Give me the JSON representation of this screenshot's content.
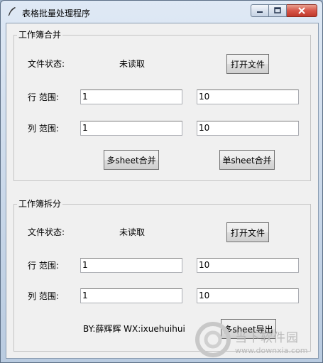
{
  "window": {
    "title": "表格批量处理程序",
    "controls": {
      "minimize": "minimize",
      "maximize": "maximize",
      "close": "close"
    }
  },
  "merge": {
    "legend": "工作簿合并",
    "status_label": "文件状态:",
    "status_value": "未读取",
    "open_button": "打开文件",
    "row_label": "行  范围:",
    "row_start": "1",
    "row_end": "10",
    "col_label": "列  范围:",
    "col_start": "1",
    "col_end": "10",
    "multi_button": "多sheet合并",
    "single_button": "单sheet合并"
  },
  "split": {
    "legend": "工作簿拆分",
    "status_label": "文件状态:",
    "status_value": "未读取",
    "open_button": "打开文件",
    "row_label": "行  范围:",
    "row_start": "1",
    "row_end": "10",
    "col_label": "列  范围:",
    "col_start": "1",
    "col_end": "10",
    "credit": "BY:薛辉辉 WX:ixuehuihui",
    "export_button": "多sheet导出"
  },
  "watermark": {
    "text": "当下软件园",
    "url": "www.downxia.com"
  }
}
